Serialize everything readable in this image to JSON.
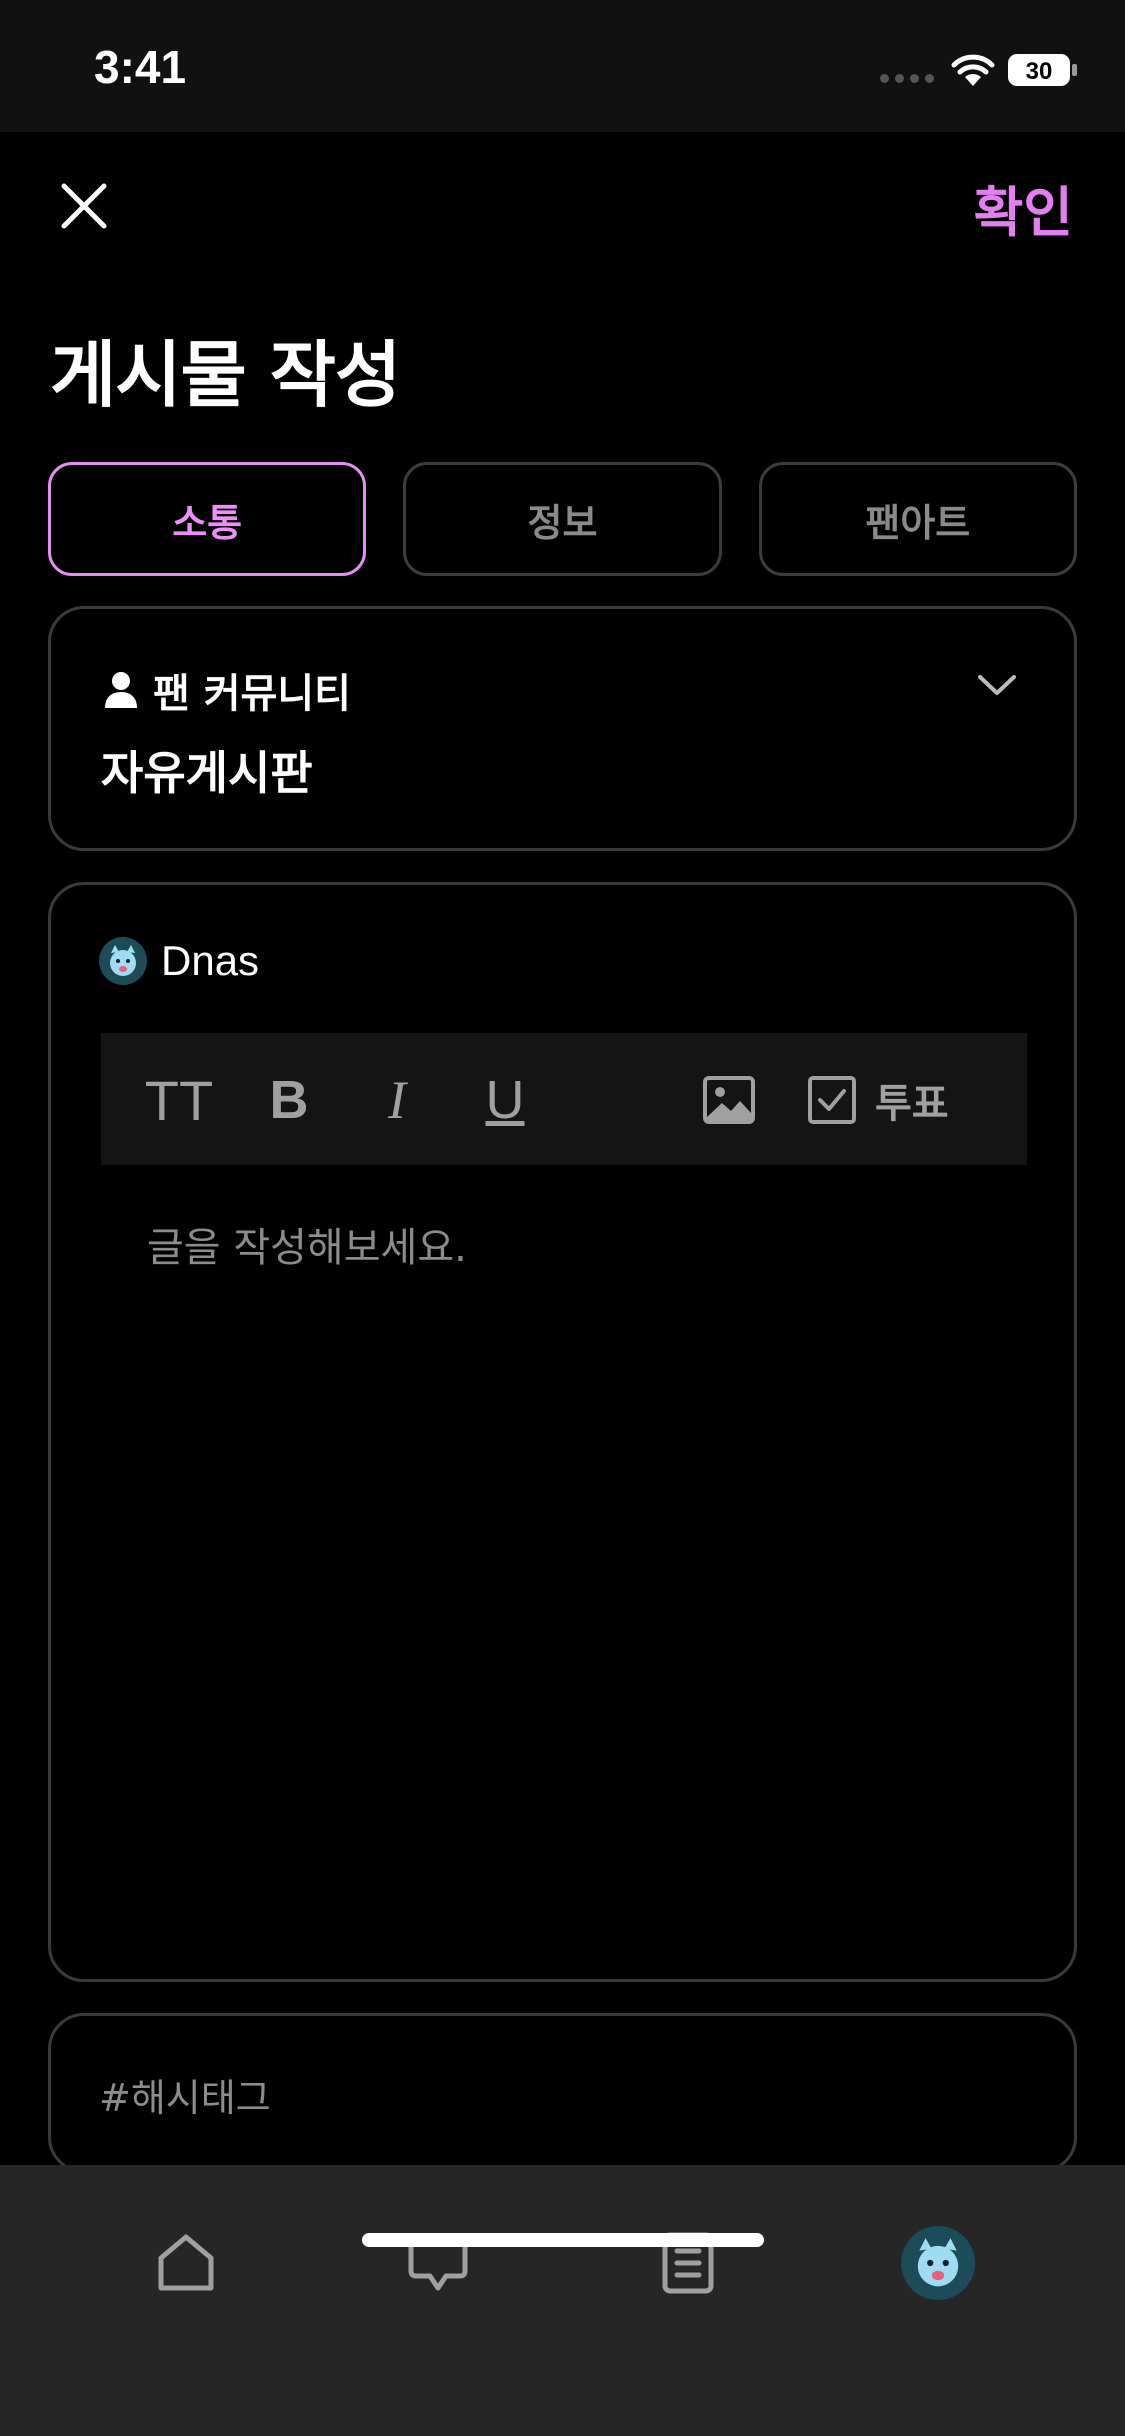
{
  "status_bar": {
    "time": "3:41",
    "battery": "30"
  },
  "header": {
    "confirm_label": "확인",
    "title": "게시물 작성"
  },
  "tabs": [
    {
      "label": "소통",
      "active": true
    },
    {
      "label": "정보",
      "active": false
    },
    {
      "label": "팬아트",
      "active": false
    }
  ],
  "board": {
    "community_label": "팬 커뮤니티",
    "board_name": "자유게시판"
  },
  "editor": {
    "author": "Dnas",
    "toolbar": {
      "text_size_glyph": "TT",
      "bold_glyph": "B",
      "italic_glyph": "I",
      "underline_glyph": "U",
      "vote_label": "투표"
    },
    "body_placeholder": "글을 작성해보세요."
  },
  "hashtag": {
    "placeholder": "#해시태그"
  },
  "colors": {
    "accent": "#e38ff2",
    "background": "#000000",
    "nav_background": "#262626"
  },
  "bottom_nav": [
    "home-icon",
    "chat-icon",
    "document-icon",
    "profile-avatar"
  ]
}
